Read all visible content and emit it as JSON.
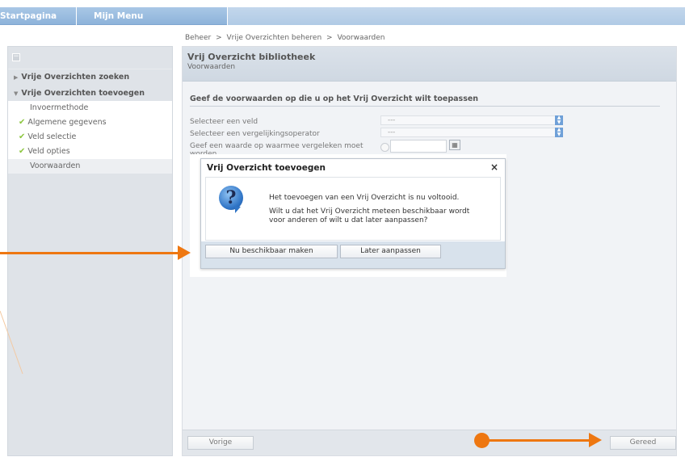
{
  "topbar": {
    "start_label": "Startpagina",
    "menu_label": "Mijn Menu"
  },
  "breadcrumb": {
    "items": [
      "Beheer",
      ">",
      "Vrije Overzichten beheren",
      ">",
      "Voorwaarden"
    ]
  },
  "sidebar": {
    "collapse_icon": "minus-icon",
    "section_search": "Vrije Overzichten zoeken",
    "section_add": "Vrije Overzichten toevoegen",
    "items": [
      {
        "label": "Invoermethode",
        "checked": false
      },
      {
        "label": "Algemene gegevens",
        "checked": true
      },
      {
        "label": "Veld selectie",
        "checked": true
      },
      {
        "label": "Veld opties",
        "checked": true
      },
      {
        "label": "Voorwaarden",
        "checked": false
      }
    ]
  },
  "main": {
    "title": "Vrij Overzicht bibliotheek",
    "subtitle": "Voorwaarden",
    "instruction": "Geef de voorwaarden op die u op het Vrij Overzicht wilt toepassen",
    "field_veld_label": "Selecteer een veld",
    "field_veld_value": "---",
    "field_op_label": "Selecteer een vergelijkingsoperator",
    "field_op_value": "---",
    "field_waarde_label": "Geef een waarde op waarmee vergeleken moet worden."
  },
  "modal": {
    "title": "Vrij Overzicht toevoegen",
    "close": "×",
    "icon": "question-icon",
    "message1": "Het toevoegen van een Vrij Overzicht is nu voltooid.",
    "message2": "Wilt u dat het Vrij Overzicht meteen beschikbaar wordt voor anderen of wilt u dat later aanpassen?",
    "button_now": "Nu beschikbaar maken",
    "button_later": "Later aanpassen"
  },
  "bottombar": {
    "prev_label": "Vorige",
    "done_label": "Gereed"
  },
  "colors": {
    "accent": "#ee7711",
    "header": "#8db3da",
    "check": "#8cc63f"
  }
}
